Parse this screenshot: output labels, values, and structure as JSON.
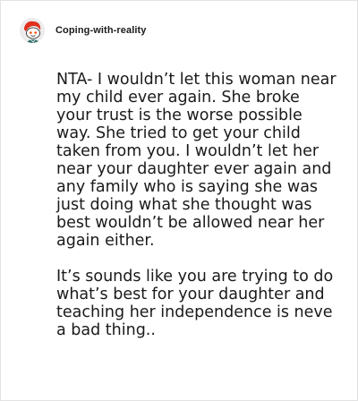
{
  "post": {
    "username": "Coping-with-reality",
    "avatar_icon": "reddit-snoo-avatar-icon",
    "paragraphs": [
      "NTA- I wouldn’t let this woman near my child ever again. She broke your trust is the worse possible way. She tried to get your child taken from you. I wouldn’t let her near your daughter ever again and any family who is saying she was just doing what she thought was best wouldn’t be allowed near her again either.",
      "It’s sounds like you are trying to do what’s best for your daughter and teaching her independence is neve a bad thing.."
    ]
  },
  "colors": {
    "text": "#1a1a1b",
    "border": "#e3e3e3",
    "avatar_accent": "#ff4500"
  }
}
